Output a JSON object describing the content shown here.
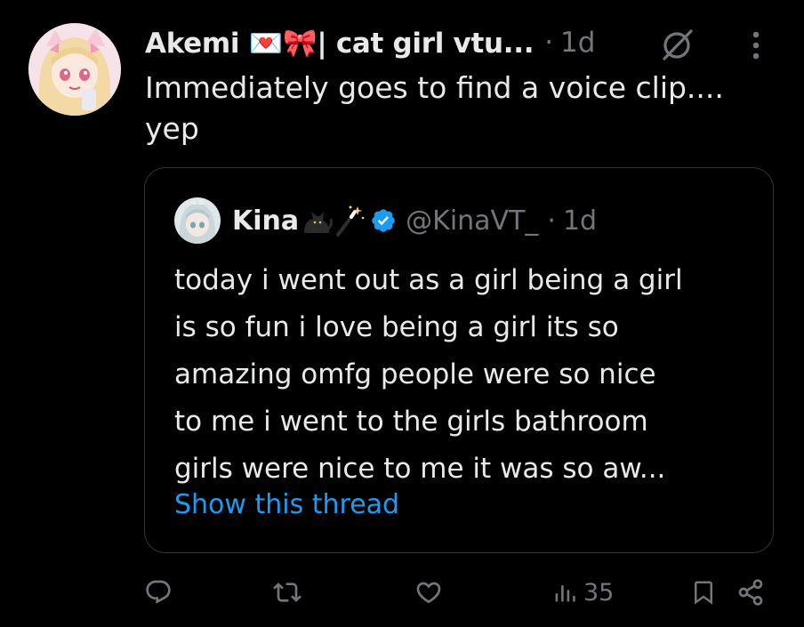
{
  "post": {
    "display_name": "Akemi 💌🎀| cat girl vtu...",
    "separator": "·",
    "time": "1d",
    "text_line1": "Immediately goes to find a voice clip....",
    "text_line2": "yep"
  },
  "quote": {
    "display_name": "Kina",
    "handle": "@KinaVT_",
    "separator": "·",
    "time": "1d",
    "lines": [
      "today i went out as a girl being a girl",
      "is so fun i love being a girl its so",
      "amazing omfg people were so nice",
      "to me i went to the girls bathroom",
      "girls were nice to me it was so aw..."
    ],
    "show_thread": "Show this thread"
  },
  "actions": {
    "views": "35"
  },
  "icons": {
    "reply": "reply-icon",
    "repost": "repost-icon",
    "like": "like-icon",
    "views": "views-icon",
    "bookmark": "bookmark-icon",
    "share": "share-icon",
    "grok": "grok-icon",
    "more": "more-icon",
    "verified": "verified-badge-icon"
  },
  "colors": {
    "background": "#000000",
    "text": "#e7e9ea",
    "secondary": "#71767b",
    "link": "#1d9bf0",
    "border": "#2f3336"
  }
}
